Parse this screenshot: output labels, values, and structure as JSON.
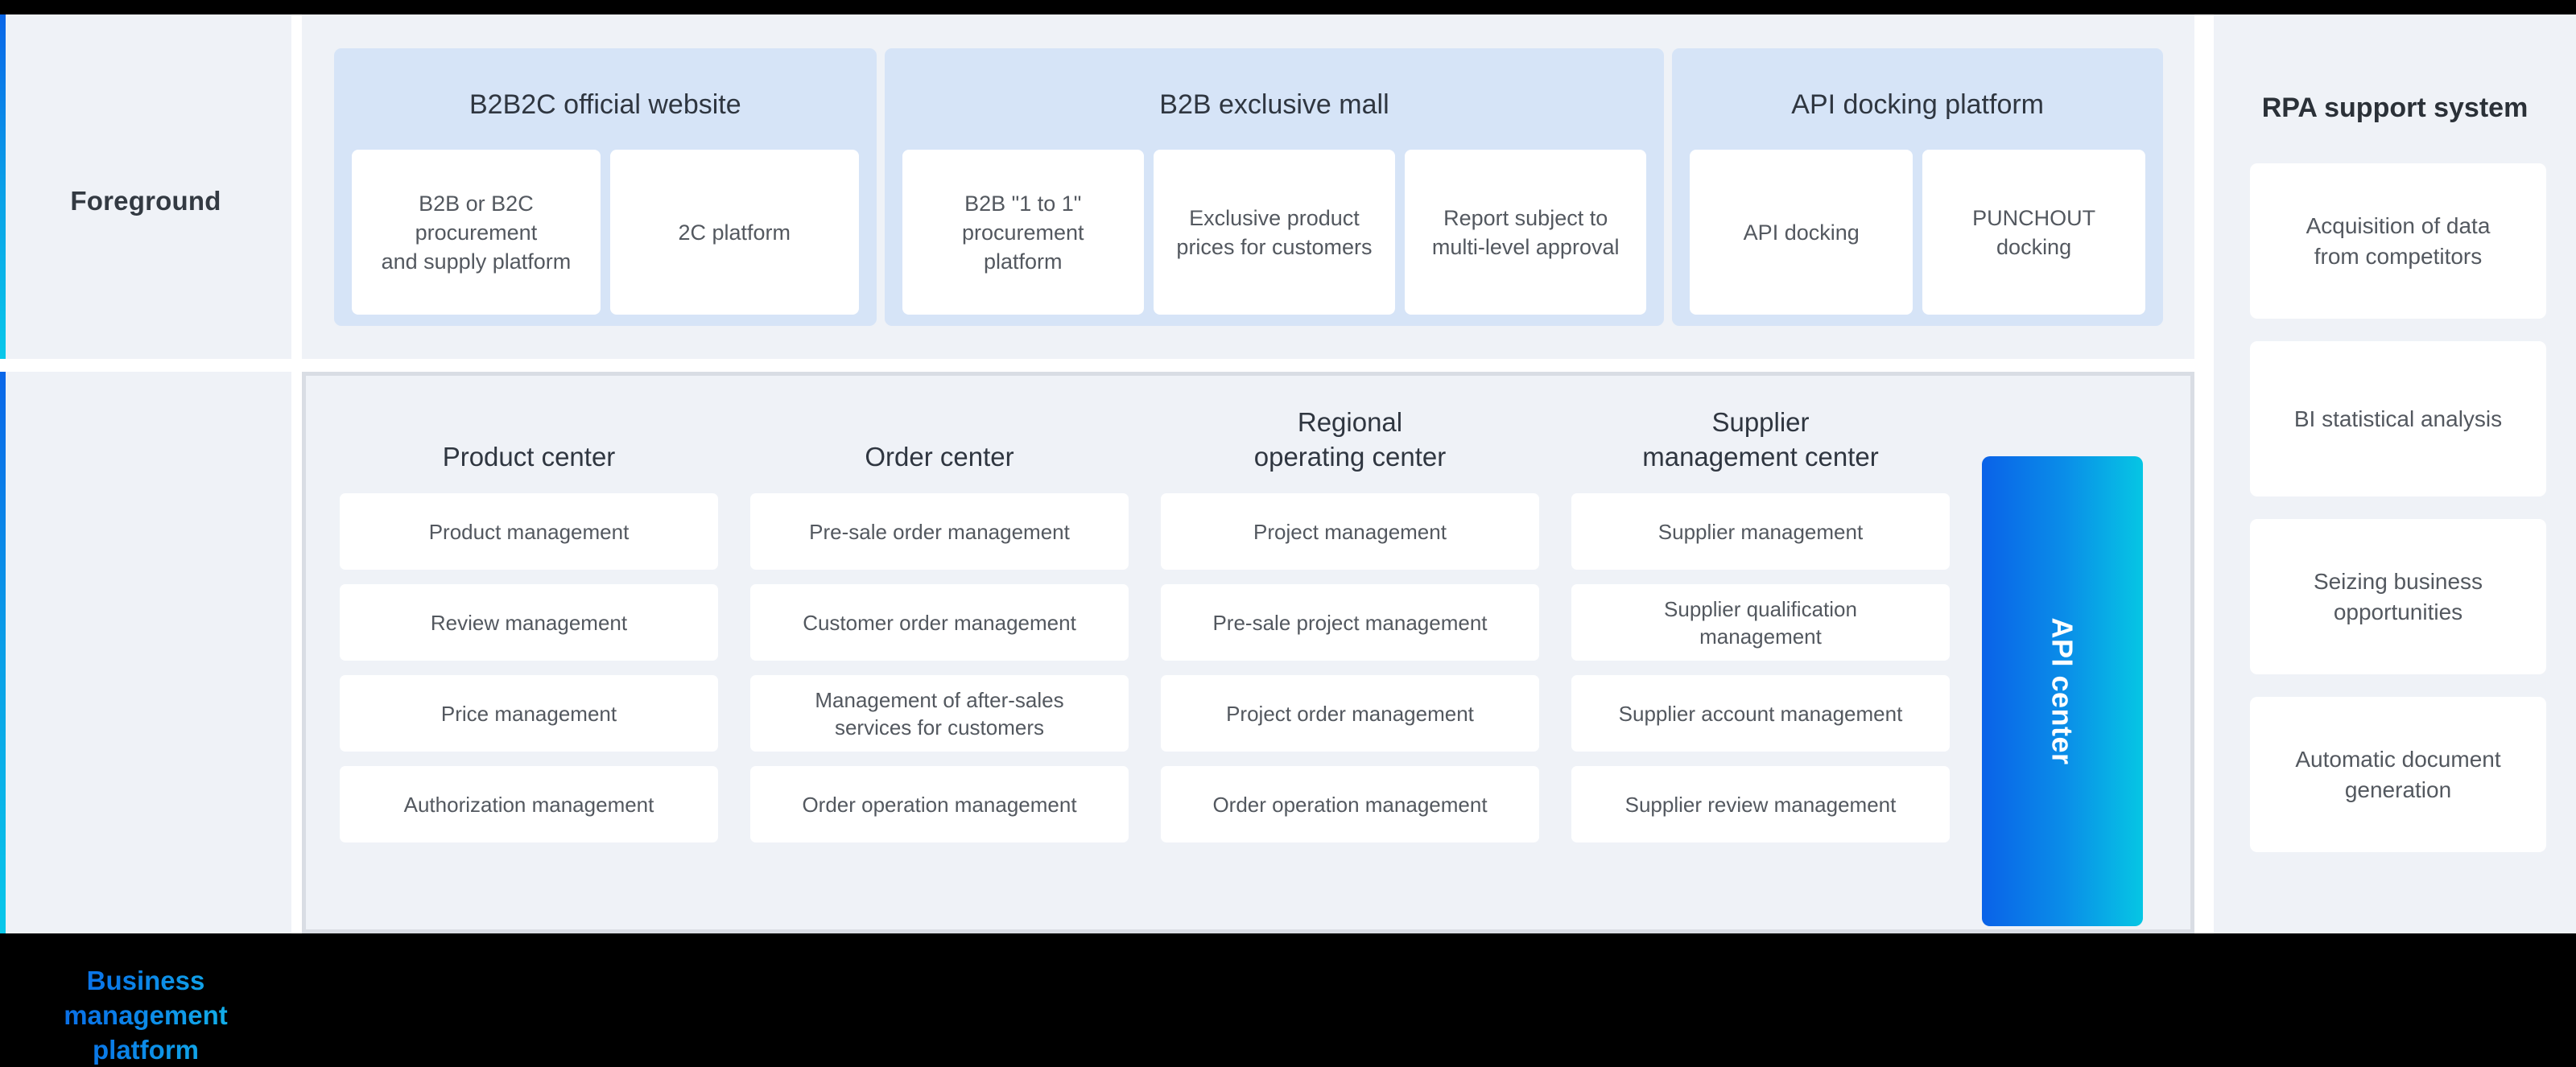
{
  "left_labels": {
    "foreground": "Foreground",
    "business_platform": "Business\nmanagement\nplatform",
    "business_platform_lines": [
      "Business",
      "management",
      "platform"
    ]
  },
  "colors": {
    "panel_bg": "#eff2f7",
    "group_bg": "#d6e4f7",
    "card_bg": "#ffffff",
    "accent_blue": "#0a62e8",
    "accent_cyan": "#06c6e4",
    "text_dark": "#2f3640",
    "text_body": "#53585f",
    "panel_border": "#d9dde4"
  },
  "foreground": {
    "groups": [
      {
        "title": "B2B2C official website",
        "tiles": [
          "B2B or B2C\nprocurement\nand supply platform",
          "2C platform"
        ],
        "tiles_lines": [
          [
            "B2B or B2C",
            "procurement",
            "and supply platform"
          ],
          [
            "2C platform"
          ]
        ]
      },
      {
        "title": "B2B exclusive mall",
        "tiles": [
          "B2B \"1 to 1\"\nprocurement\nplatform",
          "Exclusive product\nprices for customers",
          "Report subject to\nmulti-level approval"
        ],
        "tiles_lines": [
          [
            "B2B \"1 to 1\"",
            "procurement",
            "platform"
          ],
          [
            "Exclusive product",
            "prices for customers"
          ],
          [
            "Report subject to",
            "multi-level approval"
          ]
        ]
      },
      {
        "title": "API docking platform",
        "tiles": [
          "API docking",
          "PUNCHOUT\ndocking"
        ],
        "tiles_lines": [
          [
            "API docking"
          ],
          [
            "PUNCHOUT",
            "docking"
          ]
        ]
      }
    ]
  },
  "business": {
    "columns": [
      {
        "title": "Product center",
        "title_lines": [
          "Product center"
        ],
        "items": [
          "Product management",
          "Review management",
          "Price management",
          "Authorization management"
        ]
      },
      {
        "title": "Order center",
        "title_lines": [
          "Order center"
        ],
        "items": [
          "Pre-sale order management",
          "Customer order management",
          "Management of after-sales\nservices for customers",
          "Order operation management"
        ]
      },
      {
        "title": "Regional operating center",
        "title_lines": [
          "Regional",
          "operating center"
        ],
        "items": [
          "Project management",
          "Pre-sale project management",
          "Project order management",
          "Order operation management"
        ]
      },
      {
        "title": "Supplier management center",
        "title_lines": [
          "Supplier",
          "management center"
        ],
        "items": [
          "Supplier management",
          "Supplier qualification\nmanagement",
          "Supplier account management",
          "Supplier review management"
        ]
      }
    ],
    "api_center": {
      "label": "API center",
      "gradient_from": "#0a62e8",
      "gradient_to": "#06c6e4"
    }
  },
  "rpa": {
    "title": "RPA support system",
    "cards": [
      "Acquisition of data\nfrom competitors",
      "BI statistical analysis",
      "Seizing business\nopportunities",
      "Automatic document\ngeneration"
    ],
    "cards_lines": [
      [
        "Acquisition of data",
        "from competitors"
      ],
      [
        "BI statistical analysis"
      ],
      [
        "Seizing business",
        "opportunities"
      ],
      [
        "Automatic document",
        "generation"
      ]
    ]
  }
}
